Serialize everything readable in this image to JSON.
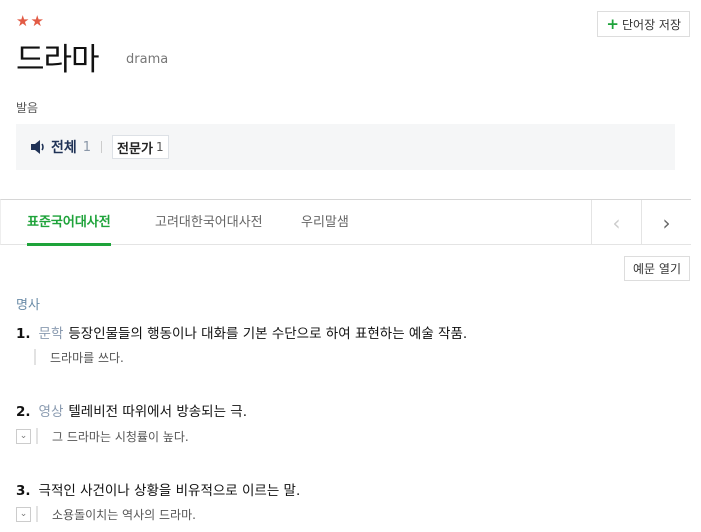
{
  "entry": {
    "stars": "★★",
    "headword": "드라마",
    "origin": "drama",
    "save_label": "단어장 저장"
  },
  "pronunciation": {
    "label": "발음",
    "all_label": "전체",
    "all_count": "1",
    "expert_label": "전문가",
    "expert_count": "1"
  },
  "tabs": [
    {
      "label": "표준국어대사전",
      "active": true
    },
    {
      "label": "고려대한국어대사전",
      "active": false
    },
    {
      "label": "우리말샘",
      "active": false
    }
  ],
  "example_toggle_label": "예문 열기",
  "pos": "명사",
  "senses": [
    {
      "num": "1.",
      "field": "문학",
      "definition": "등장인물들의 행동이나 대화를 기본 수단으로 하여 표현하는 예술 작품.",
      "example": "드라마를 쓰다.",
      "has_toggle": false
    },
    {
      "num": "2.",
      "field": "영상",
      "definition": "텔레비전 따위에서 방송되는 극.",
      "example": "그 드라마는 시청률이 높다.",
      "has_toggle": true
    },
    {
      "num": "3.",
      "field": "",
      "definition": "극적인 사건이나 상황을 비유적으로 이르는 말.",
      "example": "소용돌이치는 역사의 드라마.",
      "has_toggle": true
    }
  ],
  "colors": {
    "accent_green": "#1ea33a",
    "star_red": "#e25b45",
    "field_gray_blue": "#8a9bb0"
  }
}
